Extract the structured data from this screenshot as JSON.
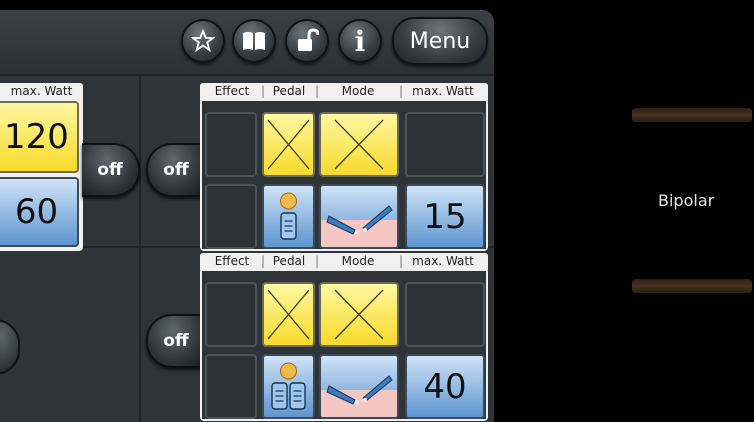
{
  "toolbar": {
    "icons": [
      "star-icon",
      "book-icon",
      "unlock-icon",
      "info-icon"
    ],
    "info_label": "i",
    "menu_label": "Menu"
  },
  "left_partial": {
    "header_label": "max. Watt",
    "value_top": "120",
    "value_bottom": "60",
    "off_label": "off"
  },
  "channels": [
    {
      "off_label": "off",
      "headers": {
        "effect": "Effect",
        "pedal": "Pedal",
        "mode": "Mode",
        "watt": "max. Watt"
      },
      "watt_value": "15",
      "pedal_count": 1
    },
    {
      "off_label": "off",
      "headers": {
        "effect": "Effect",
        "pedal": "Pedal",
        "mode": "Mode",
        "watt": "max. Watt"
      },
      "watt_value": "40",
      "pedal_count": 2
    }
  ],
  "right": {
    "label": "Bipolar"
  },
  "colors": {
    "yellow": "#f7da2a",
    "blue": "#5d95cf",
    "panel": "#2e3438"
  }
}
